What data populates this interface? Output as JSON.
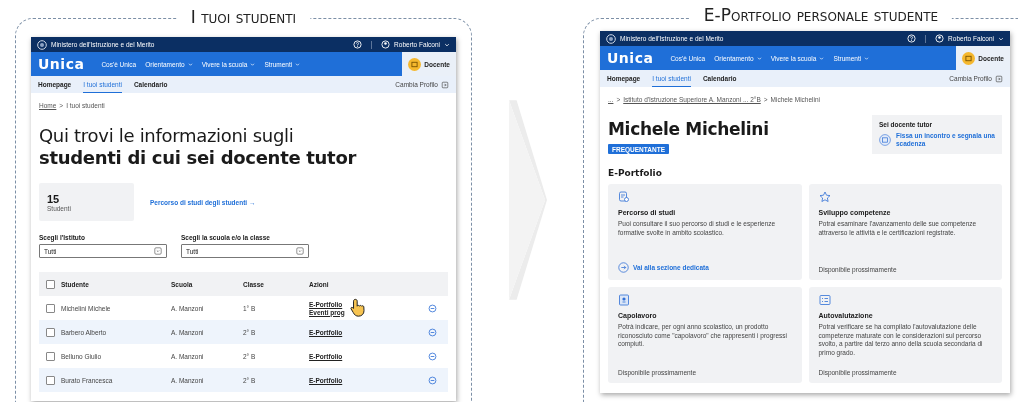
{
  "panels": [
    {
      "kind": "student_list",
      "title": "I tuoi studenti",
      "screen": {
        "topbar": {
          "ministry": "Ministero dell'Istruzione e del Merito",
          "user": "Roberto Falconi"
        },
        "header": {
          "logo": "Unica",
          "nav": [
            {
              "label": "Cos'è Unica",
              "dropdown": false
            },
            {
              "label": "Orientamento",
              "dropdown": true
            },
            {
              "label": "Vivere la scuola",
              "dropdown": true
            },
            {
              "label": "Strumenti",
              "dropdown": true
            }
          ],
          "profile": "Docente"
        },
        "tabs": [
          {
            "label": "Homepage",
            "selected": false
          },
          {
            "label": "I tuoi studenti",
            "selected": true
          },
          {
            "label": "Calendario",
            "selected": false
          }
        ],
        "switch_profile": "Cambia Profilo",
        "breadcrumb_separator": ">",
        "breadcrumb": [
          "Home",
          "I tuoi studenti"
        ],
        "heading": "Qui trovi le informazioni sugli\n**studenti di cui sei docente tutor**",
        "stat": {
          "value": "15",
          "label": "Studenti"
        },
        "stat_link": "Percorso di studi degli studenti →",
        "filters": [
          {
            "label": "Scegli l'Istituto",
            "value": "Tutti"
          },
          {
            "label": "Scegli la scuola e/o la classe",
            "value": "Tutti"
          }
        ],
        "table": {
          "header_checked": false,
          "columns": [
            "Studente",
            "Scuola",
            "Classe",
            "Azioni"
          ],
          "rows": [
            {
              "checked": false,
              "student": "Michelini Michele",
              "school": "A. Manzoni",
              "class": "1° B",
              "actions": [
                "E-Portfolio",
                "Eventi prog"
              ],
              "pointer": true
            },
            {
              "checked": false,
              "student": "Barbero Alberto",
              "school": "A. Manzoni",
              "class": "2° B",
              "actions": [
                "E-Portfolio"
              ],
              "pointer": false
            },
            {
              "checked": false,
              "student": "Belluno Giulio",
              "school": "A. Manzoni",
              "class": "2° B",
              "actions": [
                "E-Portfolio"
              ],
              "pointer": false
            },
            {
              "checked": false,
              "student": "Burato Francesca",
              "school": "A. Manzoni",
              "class": "2° B",
              "actions": [
                "E-Portfolio"
              ],
              "pointer": false
            }
          ]
        }
      }
    },
    {
      "kind": "student_profile",
      "title": "E-Portfolio personale studente",
      "screen": {
        "topbar": {
          "ministry": "Ministero dell'Istruzione e del Merito",
          "user": "Roberto Falconi"
        },
        "header": {
          "logo": "Unica",
          "nav": [
            {
              "label": "Cos'è Unica",
              "dropdown": false
            },
            {
              "label": "Orientamento",
              "dropdown": true
            },
            {
              "label": "Vivere la scuola",
              "dropdown": true
            },
            {
              "label": "Strumenti",
              "dropdown": true
            }
          ],
          "profile": "Docente"
        },
        "tabs": [
          {
            "label": "Homepage",
            "selected": false
          },
          {
            "label": "I tuoi studenti",
            "selected": true
          },
          {
            "label": "Calendario",
            "selected": false
          }
        ],
        "switch_profile": "Cambia Profilo",
        "breadcrumb_separator": ">",
        "breadcrumb": [
          "...",
          "Istituto d'Istruzione Superiore A. Manzoni ... 2°B",
          "Michele Michelini"
        ],
        "name": "Michele Michelini",
        "status": "FREQUENTANTE",
        "tutor": {
          "title": "Sei docente tutor",
          "link": "Fissa un incontro e segnala una scadenza"
        },
        "section": "E-Portfolio",
        "cards": [
          {
            "title": "Percorso di studi",
            "text": "Puoi consultare il suo percorso di studi e le esperienze formative svolte in ambito scolastico.",
            "footer": {
              "kind": "link",
              "label": "Vai alla sezione dedicata"
            }
          },
          {
            "title": "Sviluppo competenze",
            "text": "Potrai esaminare l'avanzamento delle sue competenze attraverso le attività e le certificazioni registrate.",
            "footer": {
              "kind": "note",
              "label": "Disponibile prossimamente"
            }
          },
          {
            "title": "Capolavoro",
            "text": "Potrà indicare, per ogni anno scolastico, un prodotto riconosciuto come \"capolavoro\" che rappresenti i progressi compiuti.",
            "footer": {
              "kind": "note",
              "label": "Disponibile prossimamente"
            }
          },
          {
            "title": "Autovalutazione",
            "text": "Potrai verificare se ha compilato l'autovalutazione delle competenze maturate con le considerazioni sul percorso svolto, a partire dal terzo anno della scuola secondaria di primo grado.",
            "footer": {
              "kind": "note",
              "label": "Disponibile prossimamente"
            }
          }
        ]
      }
    }
  ]
}
